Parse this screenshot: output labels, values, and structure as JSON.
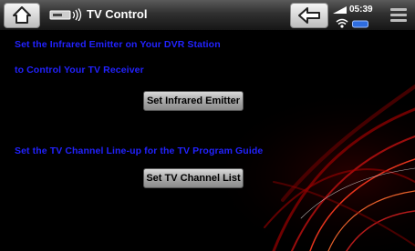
{
  "header": {
    "title": "TV Control",
    "clock": "05:39",
    "icons": [
      "home-icon",
      "ir-emitter-icon",
      "back-arrow-icon",
      "battery-icon",
      "wifi-icon",
      "storage-icon",
      "menu-icon"
    ]
  },
  "section1": {
    "line1": "Set the Infrared Emitter on Your DVR Station",
    "line2": "to Control Your TV Receiver",
    "button": "Set Infrared Emitter"
  },
  "section2": {
    "line": "Set the TV Channel Line-up for the TV Program Guide",
    "button": "Set TV Channel List"
  },
  "colors": {
    "text": "#2222ff",
    "background": "#000000"
  }
}
